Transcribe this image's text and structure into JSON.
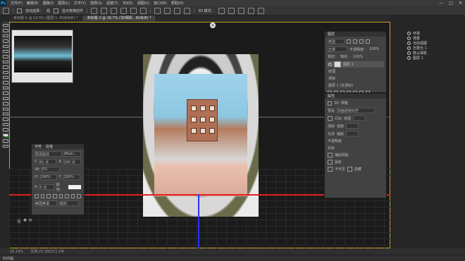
{
  "menubar": {
    "logo": "Ps",
    "items": [
      "文件(F)",
      "编辑(E)",
      "图像(I)",
      "图层(L)",
      "文字(Y)",
      "选择(S)",
      "滤镜(T)",
      "3D(D)",
      "视图(V)",
      "窗口(W)",
      "帮助(H)"
    ],
    "window_controls": [
      "—",
      "□",
      "✕"
    ]
  },
  "options_bar": {
    "auto_select_label": "自动选择：",
    "auto_select_target": "组",
    "show_transform_label": "显示变换控件",
    "mode_3d_label": "3D 模式："
  },
  "tabs": [
    {
      "label": "未标题-1 @ 12.5% (图层 1, RGB/8#) *",
      "active": false
    },
    {
      "label": "未标题-2 @ 16.7% (3D相机 , RGB/8) *",
      "active": true
    }
  ],
  "character_panel": {
    "tabs": [
      "字符",
      "段落"
    ],
    "font_family": "思源黑体",
    "font_style": "Medi...",
    "size": "61 点",
    "leading": "100 点",
    "tracking": "0%",
    "vscale": "100%",
    "hscale": "100%",
    "baseline": "0 点",
    "color_label": "颜色：",
    "language": "美国英语",
    "antialias": "锐利"
  },
  "layers_panel": {
    "title": "图层",
    "kind_label": "类型",
    "blend_mode": "正常",
    "opacity_label": "不透明度：",
    "opacity": "100%",
    "lock_label": "锁定：",
    "fill_label": "填充：",
    "fill": "100%",
    "rows": [
      {
        "name": "图层 1"
      },
      {
        "name": "纹理"
      },
      {
        "name": "漫射"
      },
      {
        "name": "图层 1 (无漫射)"
      }
    ]
  },
  "properties_panel": {
    "title": "属性",
    "tab": "3D",
    "layer_label": "网格",
    "preset_label": "预设",
    "preset_value": "前面逐帧对齐",
    "sections": [
      "凸出",
      "漫射",
      "光泽",
      "不透明度",
      "反射"
    ],
    "field_labels": [
      "纹理",
      "强度",
      "缩放"
    ],
    "checkbox_labels": [
      "捕捉阴影",
      "投影",
      "不可见",
      "隐藏"
    ]
  },
  "right_panel": {
    "items": [
      "环境",
      "场景",
      "当前视图",
      "无限光 1",
      "默认相机",
      "图层 1"
    ]
  },
  "status_bar": {
    "zoom": "16.19%",
    "doc_info": "文档:25.1M/211.1M"
  },
  "bottom_bar": {
    "label": "时间轴"
  },
  "colors": {
    "accent_frame": "#c7a32b",
    "red_axis": "#e21f1f",
    "blue_axis": "#2233ff",
    "foreground": "#f4f4f4",
    "background": "#4caf50"
  }
}
